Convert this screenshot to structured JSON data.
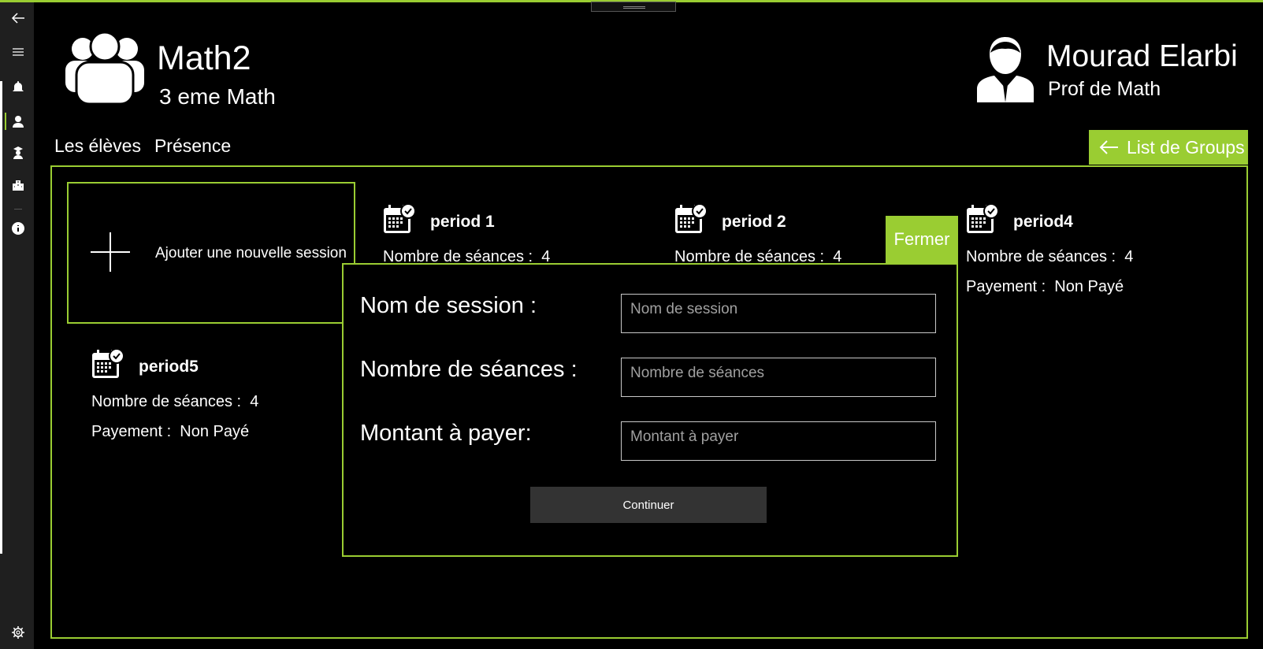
{
  "sidebar": {
    "back_icon": "arrow-left-icon",
    "items": [
      {
        "name": "menu-icon"
      },
      {
        "name": "bell-icon"
      },
      {
        "name": "teacher-icon"
      },
      {
        "name": "student-icon"
      },
      {
        "name": "building-icon"
      },
      {
        "name": "info-icon"
      }
    ],
    "settings_icon": "gear-icon"
  },
  "header": {
    "group_name": "Math2",
    "group_level": "3 eme Math",
    "user_name": "Mourad Elarbi",
    "user_role": "Prof de  Math"
  },
  "tabs": [
    {
      "label": "Les élèves"
    },
    {
      "label": "Présence"
    }
  ],
  "list_groups_button": "List de Groups",
  "add_session_label": "Ajouter une nouvelle session",
  "periods": [
    {
      "name": "period 1",
      "seances_label": "Nombre de séances :",
      "seances": "4"
    },
    {
      "name": "period 2",
      "seances_label": "Nombre de séances :",
      "seances": "4"
    },
    {
      "name": "period4",
      "seances_label": "Nombre de séances :",
      "seances": "4",
      "payement_label": "Payement :",
      "payement": "Non Payé"
    },
    {
      "name": "period5",
      "seances_label": "Nombre de séances :",
      "seances": "4",
      "payement_label": "Payement :",
      "payement": "Non Payé"
    }
  ],
  "fermer_button": "Fermer",
  "dialog": {
    "fields": [
      {
        "label": "Nom de session :",
        "placeholder": "Nom de session",
        "value": ""
      },
      {
        "label": "Nombre de séances :",
        "placeholder": "Nombre de séances",
        "value": ""
      },
      {
        "label": "Montant à payer:",
        "placeholder": "Montant à payer",
        "value": ""
      }
    ],
    "continue_button": "Continuer"
  },
  "colors": {
    "accent": "#9acd32",
    "background": "#000000",
    "sidebar": "#1f1f1f"
  }
}
